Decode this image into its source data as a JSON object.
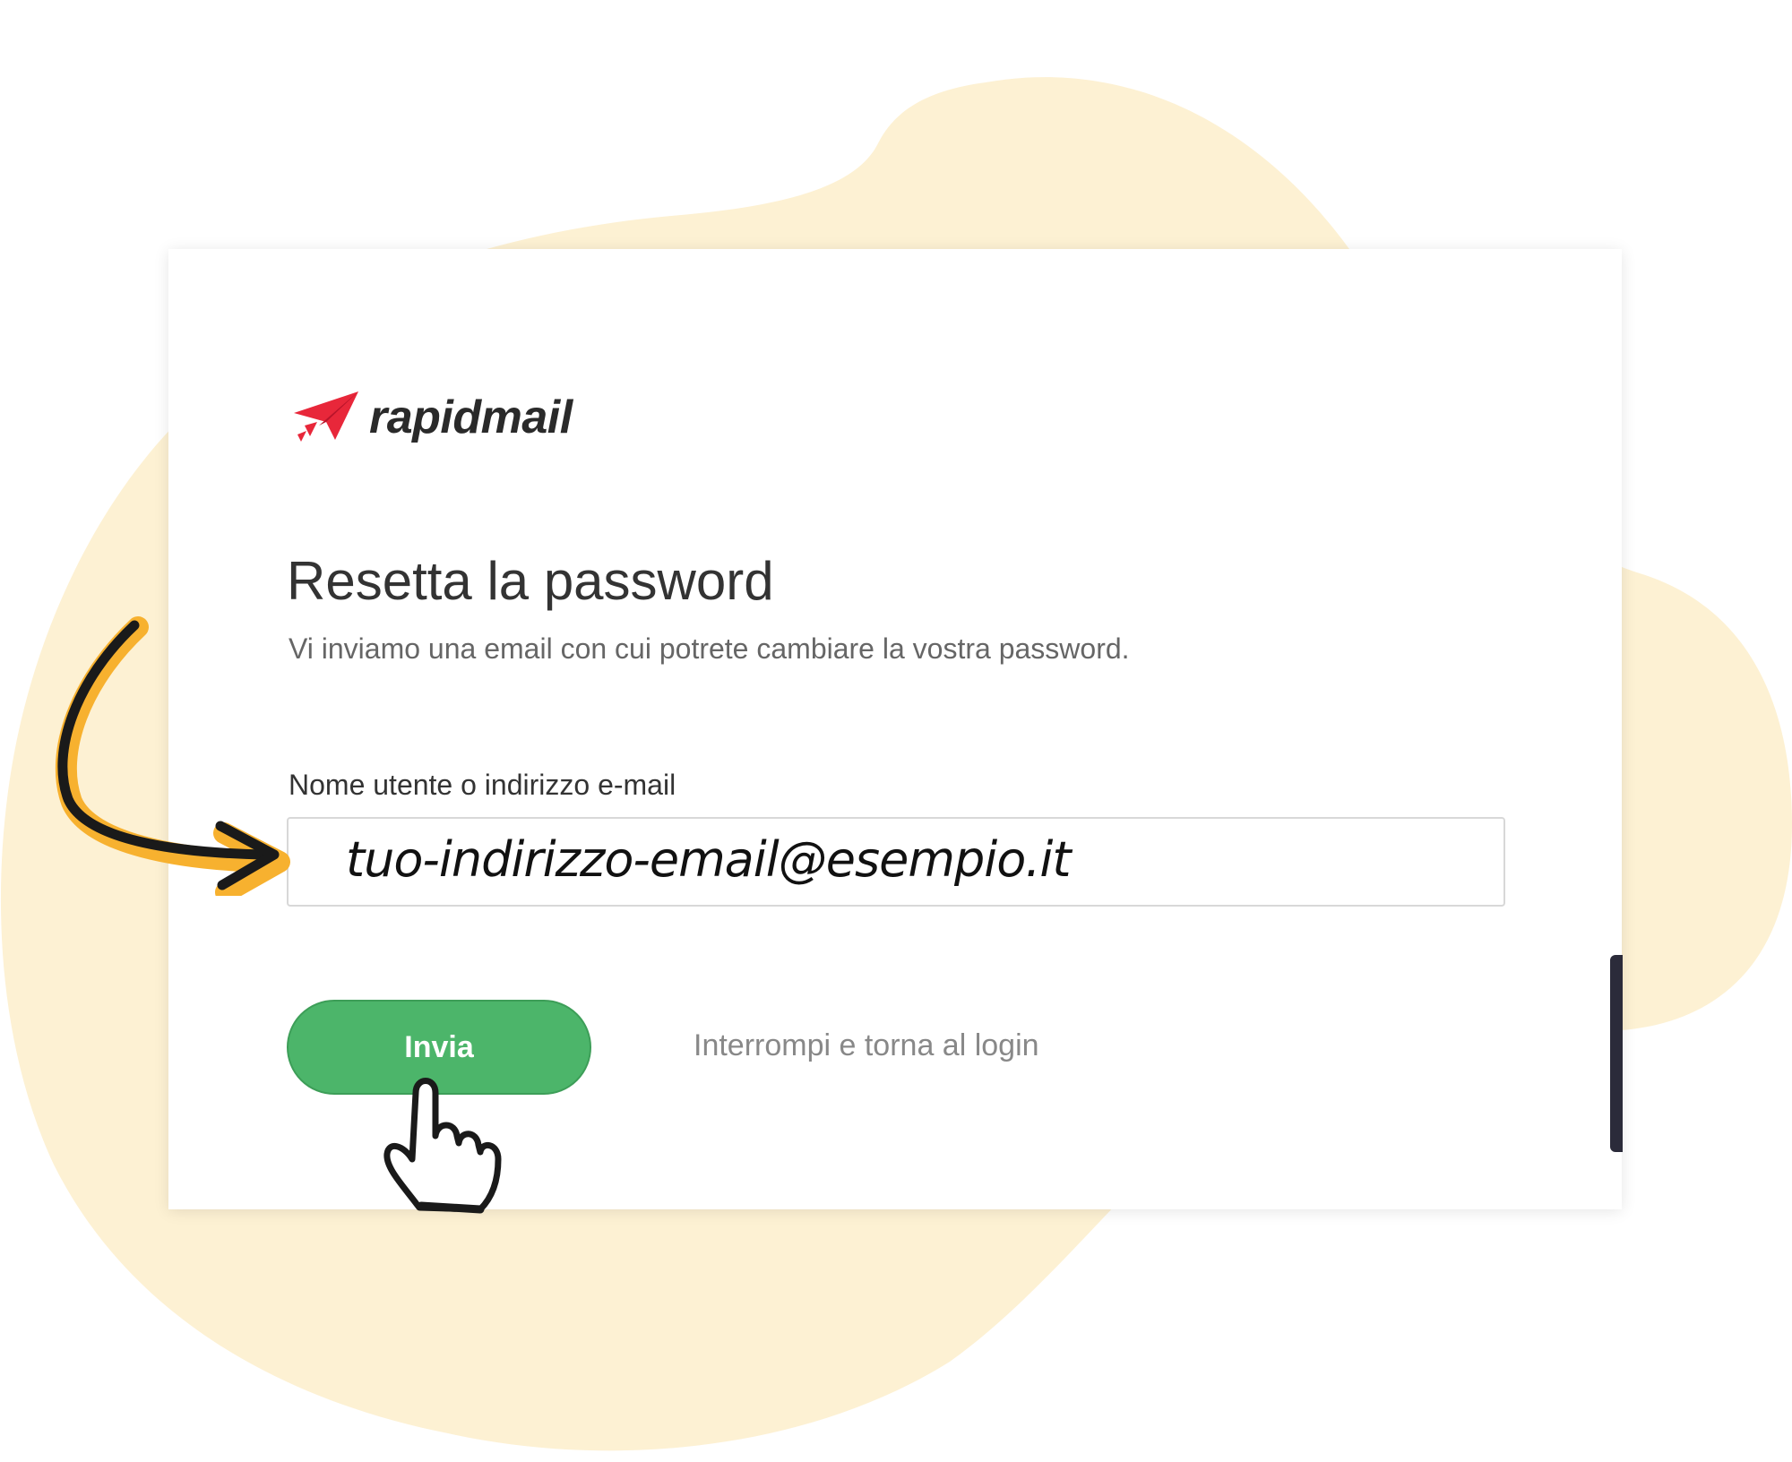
{
  "colors": {
    "blob": "#fdf1d3",
    "brand_red": "#e8273a",
    "button_green": "#4cb56a",
    "arrow_orange": "#f7b12f"
  },
  "brand": {
    "name": "rapidmail",
    "icon": "paper-plane-icon"
  },
  "page": {
    "title": "Resetta la password",
    "subtitle": "Vi inviamo una email con cui potrete cambiare la vostra password."
  },
  "form": {
    "field_label": "Nome utente o indirizzo e-mail",
    "field_value": "tuo-indirizzo-email@esempio.it",
    "submit_label": "Invia",
    "cancel_label": "Interrompi e torna al login"
  },
  "annotations": {
    "arrow_icon": "hand-drawn-arrow-icon",
    "pointer_icon": "pointing-hand-icon"
  }
}
